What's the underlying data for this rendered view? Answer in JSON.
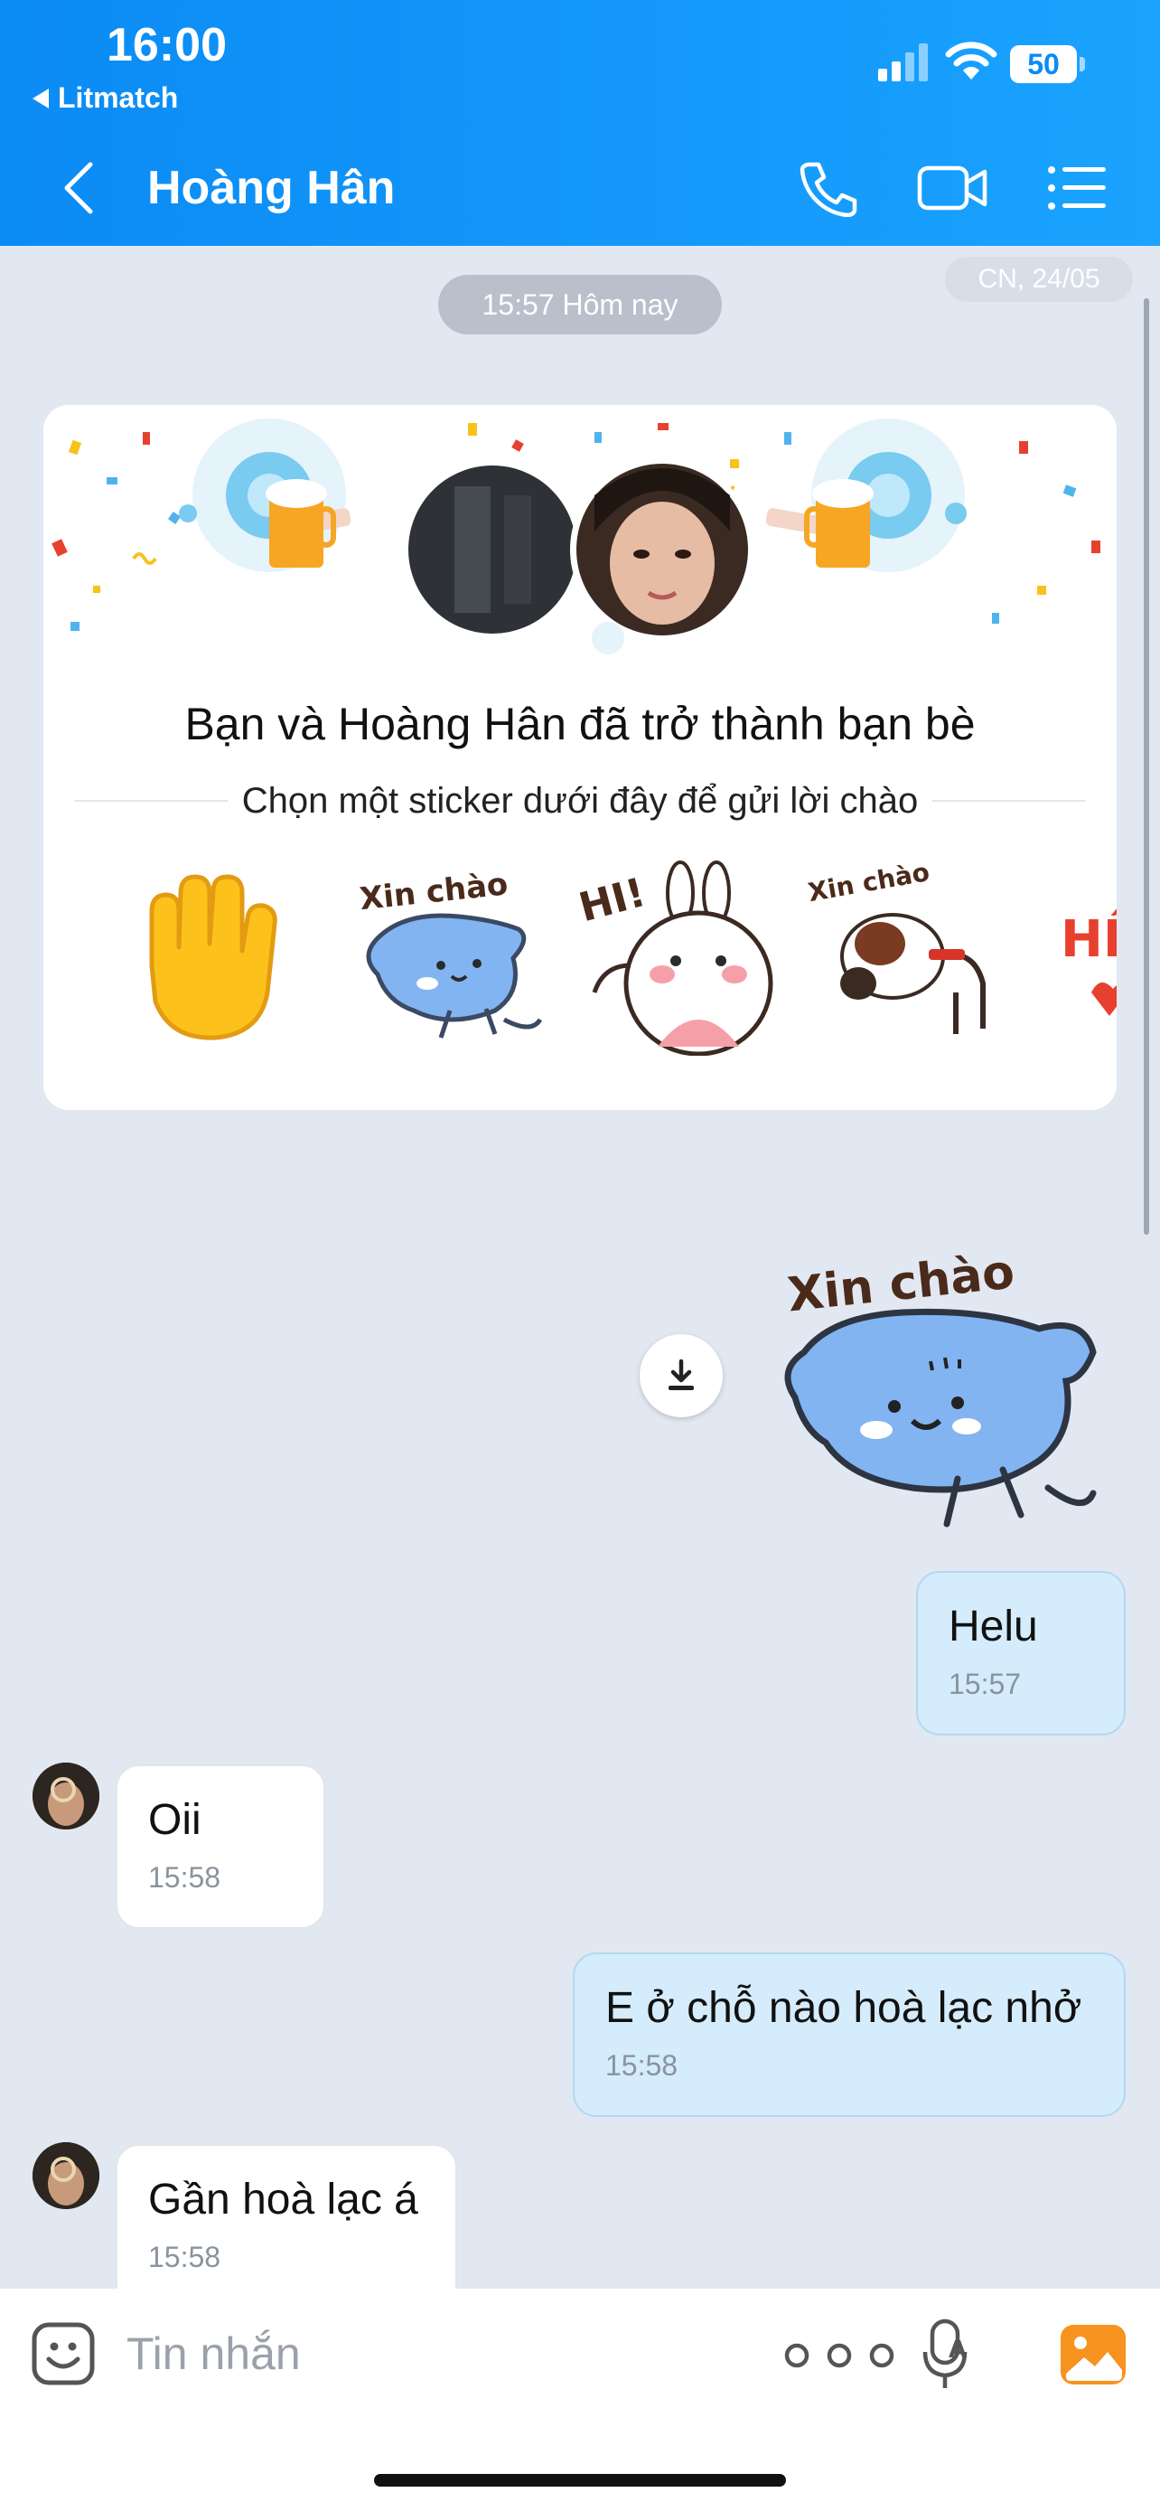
{
  "status_bar": {
    "time": "16:00",
    "back_app": "Litmatch",
    "battery": "50"
  },
  "header": {
    "contact_name": "Hoàng Hân",
    "icons": [
      "chevron-left-icon",
      "phone-icon",
      "video-camera-icon",
      "list-menu-icon"
    ]
  },
  "chat": {
    "date_label": "CN, 24/05",
    "time_divider": "15:57 Hôm nay",
    "friend_card": {
      "title": "Bạn và Hoàng Hân đã trở thành bạn bè",
      "subtitle": "Chọn một sticker dưới đây để gửi lời chào",
      "sticker_texts": [
        "Xin chào",
        "HI!",
        "Xin chào",
        "HÊ"
      ]
    },
    "sent_sticker_text": "Xin chào",
    "messages": [
      {
        "from": "me",
        "text": "Helu",
        "time": "15:57"
      },
      {
        "from": "them",
        "text": "Oii",
        "time": "15:58"
      },
      {
        "from": "me",
        "text": "E ở chỗ nào hoà lạc nhở",
        "time": "15:58"
      },
      {
        "from": "them",
        "text": "Gần hoà lạc á",
        "time": "15:58"
      }
    ]
  },
  "composer": {
    "placeholder": "Tin nhắn",
    "icons": [
      "emoji-icon",
      "more-icon",
      "voice-to-text-icon",
      "image-icon"
    ]
  },
  "colors": {
    "header_gradient_start": "#0b8bf4",
    "header_gradient_end": "#1aa3ff",
    "chat_background": "#e2e8f2",
    "my_bubble": "#d4ecfb",
    "their_bubble": "#ffffff",
    "image_button": "#f7931e"
  }
}
